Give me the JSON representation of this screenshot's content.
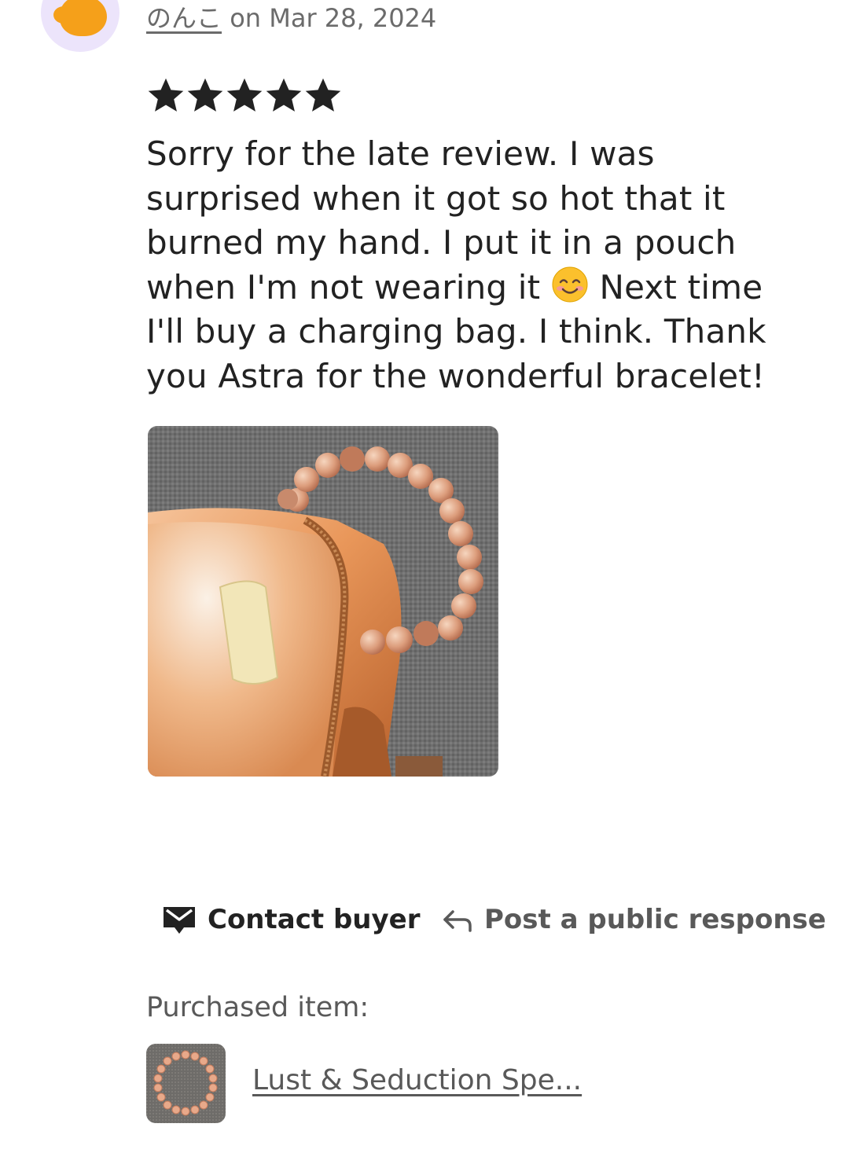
{
  "review": {
    "reviewer_name": "のんこ",
    "date_text": " on Mar 28, 2024",
    "rating": 5,
    "text_part1": "Sorry for the late review. I was surprised when it got so hot that it burned my hand. I put it in a pouch when I'm not wearing it ",
    "text_part2": " Next time I'll buy a charging bag. I think. Thank you Astra for the wonderful bracelet!",
    "emoji_name": "smiling-face-with-smiling-eyes-icon"
  },
  "actions": {
    "contact_label": "Contact buyer",
    "respond_label": "Post a public response"
  },
  "purchased": {
    "label": "Purchased item:",
    "item_title": "Lust & Seduction Spe..."
  },
  "colors": {
    "avatar_bg": "#ece4fb",
    "avatar_fg": "#f5a01a",
    "text_primary": "#222222",
    "text_secondary": "#595959"
  }
}
